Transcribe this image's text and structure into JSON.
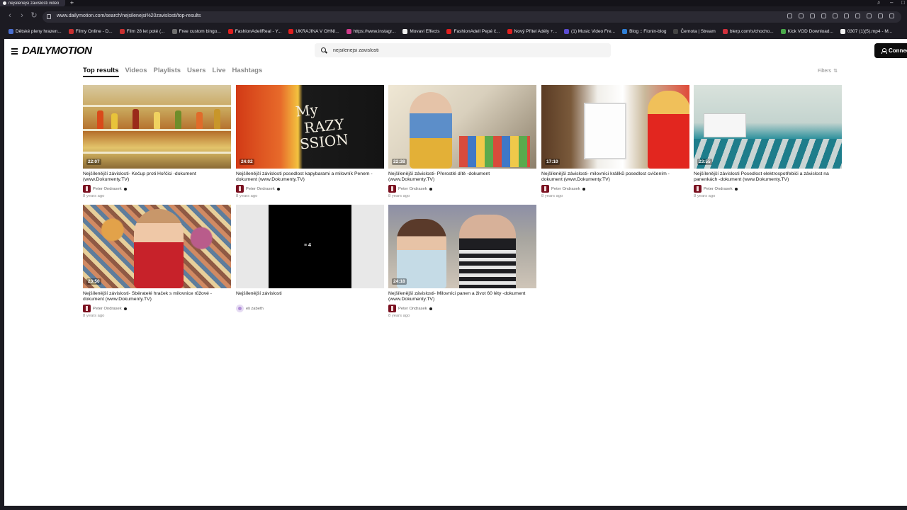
{
  "browser": {
    "tab_title": "nejsilenejsi zavislosti video",
    "url": "www.dailymotion.com/search/nejsilenejsi%20zavislosti/top-results",
    "bookmarks": [
      {
        "label": "Dětské pleny hrazen...",
        "color": "#4a6fd0"
      },
      {
        "label": "Filmy Online - D...",
        "color": "#c83030"
      },
      {
        "label": "Film 28 let poté (...",
        "color": "#c83030"
      },
      {
        "label": "Free custom bingo...",
        "color": "#6f6f6f"
      },
      {
        "label": "FashionAdellReal - Y...",
        "color": "#e02020"
      },
      {
        "label": "UKRAJINA V OHNI...",
        "color": "#e02020"
      },
      {
        "label": "https://www.instagr...",
        "color": "#d23c8c"
      },
      {
        "label": "Movavi Effects",
        "color": "#f0f0f0"
      },
      {
        "label": "FashionAdell Pepé č...",
        "color": "#e02020"
      },
      {
        "label": "Nový Přítel Adély +...",
        "color": "#e02020"
      },
      {
        "label": "(1) Music Video Fre...",
        "color": "#5b4bd0"
      },
      {
        "label": "Blog :: Fionin-blog",
        "color": "#2f7fd6"
      },
      {
        "label": "Černota | Stream",
        "color": "#444444"
      },
      {
        "label": "blerp.com/s/chocho...",
        "color": "#d0303c"
      },
      {
        "label": "Kick VOD Download...",
        "color": "#4aa84a"
      },
      {
        "label": "0307 (1)(5).mp4 - M...",
        "color": "#f0f0f0"
      }
    ]
  },
  "header": {
    "logo": "DAILYMOTION",
    "search_value": "nejsilenejsi zavislosti",
    "connect_label": "Connect"
  },
  "tabs": [
    {
      "label": "Top results"
    },
    {
      "label": "Videos"
    },
    {
      "label": "Playlists"
    },
    {
      "label": "Users"
    },
    {
      "label": "Live"
    },
    {
      "label": "Hashtags"
    }
  ],
  "filters_label": "Filters",
  "videos": [
    {
      "title": "Nejšílenější závislosti- Kečup proti Hořčici -dokument (www.Dokumenty.TV)",
      "channel": "Peter Ondrasek",
      "age": "8 years ago",
      "duration": "22:07"
    },
    {
      "title": "Nejšílenější závislosti posedlost kapybarami a milovník Penem -dokument (www.Dokumenty.TV)",
      "channel": "Peter Ondrasek",
      "age": "8 years ago",
      "duration": "24:02"
    },
    {
      "title": "Nejšílenější závislosti- Přerostlé dítě -dokument (www.Dokumenty.TV)",
      "channel": "Peter Ondrasek",
      "age": "8 years ago",
      "duration": "22:38"
    },
    {
      "title": "Nejšílenější závislosti- milovníci králíků posedlost cvičením -dokument (www.Dokumenty.TV)",
      "channel": "Peter Ondrasek",
      "age": "8 years ago",
      "duration": "17:10"
    },
    {
      "title": "Nejšílenější závislosti Posedlost elektrospotřebiči a závislost na panenkách -dokument (www.Dokumenty.TV)",
      "channel": "Peter Ondrasek",
      "age": "8 years ago",
      "duration": "23:55"
    },
    {
      "title": "Nejšílenější závislosti- Sběratelé hraček s milovnice růžové -dokument (www.Dokumenty.TV)",
      "channel": "Peter Ondrasek",
      "age": "8 years ago",
      "duration": "23:50"
    },
    {
      "title": "Nejšílenější závislosti",
      "channel": "eli zabeth",
      "age": "",
      "playlist_count": "4"
    },
    {
      "title": "Nejšílenější závislosti- Milovníci panen a život 60 léty -dokument (www.Dokumenty.TV)",
      "channel": "Peter Ondrasek",
      "age": "8 years ago",
      "duration": "24:18"
    }
  ]
}
